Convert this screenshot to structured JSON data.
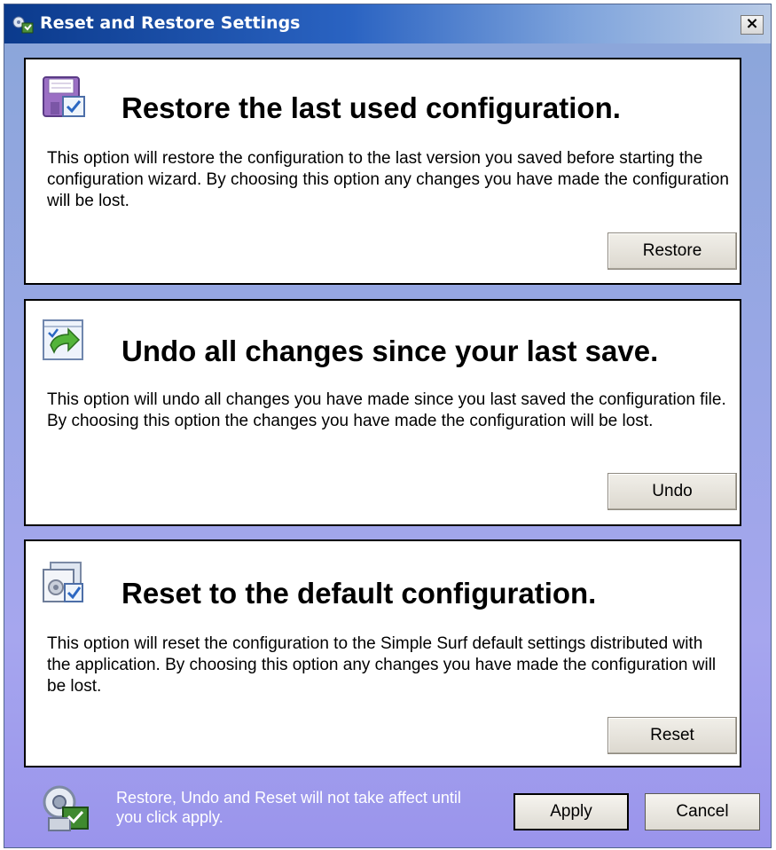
{
  "window": {
    "title": "Reset and Restore Settings",
    "close_label": "×"
  },
  "panels": [
    {
      "title": "Restore the last used configuration.",
      "description": "This option will restore the configuration to the last version you saved before starting the configuration wizard.  By choosing this option any changes you have made the configuration will be lost.",
      "button": "Restore",
      "icon": "floppy-disk-icon"
    },
    {
      "title": "Undo all changes since your last save.",
      "description": "This option will undo all changes you have made since you last saved the configuration file.  By choosing this option the changes you have made the configuration will be lost.",
      "button": "Undo",
      "icon": "undo-arrow-icon"
    },
    {
      "title": "Reset to the default configuration.",
      "description": "This option will reset the configuration to the Simple Surf default settings distributed with the application.  By choosing this option any changes you have made the configuration will be lost.",
      "button": "Reset",
      "icon": "reset-settings-icon"
    }
  ],
  "footer": {
    "note": "Restore, Undo and Reset will not take affect until you click apply.",
    "apply_label": "Apply",
    "cancel_label": "Cancel",
    "icon": "gear-info-icon"
  },
  "colors": {
    "titlebar_start": "#0b3a8c",
    "background": "#9aa7e6",
    "panel_border": "#000000"
  }
}
